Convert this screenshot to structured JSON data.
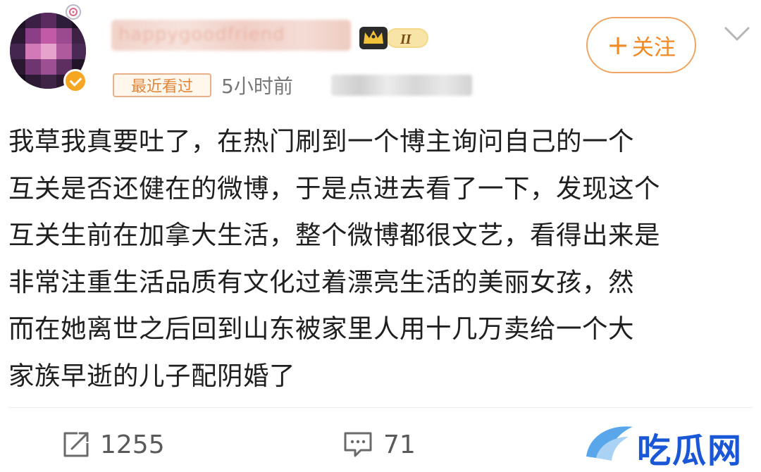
{
  "user": {
    "username": "happygoodfriend",
    "vip_level": "II"
  },
  "follow_button": {
    "plus": "+",
    "label": "关注"
  },
  "meta": {
    "recent_tag": "最近看过",
    "time": "5小时前"
  },
  "post": {
    "lines": [
      "我草我真要吐了，在热门刷到一个博主询问自己的一个",
      "互关是否还健在的微博，于是点进去看了一下，发现这个",
      "互关生前在加拿大生活，整个微博都很文艺，看得出来是",
      "非常注重生活品质有文化过着漂亮生活的美丽女孩，然",
      "而在她离世之后回到山东被家里人用十几万卖给一个大",
      "家族早逝的儿子配阴婚了"
    ]
  },
  "actions": {
    "repost_count": "1255",
    "comment_count": "71"
  },
  "watermark": {
    "text": "吃瓜网"
  },
  "colors": {
    "accent_orange": "#f08a25",
    "follow_border": "#f0a463",
    "tag_border": "#e8b08a",
    "watermark_blue": "#1a57d6",
    "text_main": "#1f1f1f",
    "text_muted": "#777777"
  },
  "icons": {
    "repost": "repost-icon",
    "comment": "comment-icon",
    "chevron": "chevron-down-icon",
    "verified": "verified-badge-icon",
    "vip": "vip-crown-icon"
  }
}
